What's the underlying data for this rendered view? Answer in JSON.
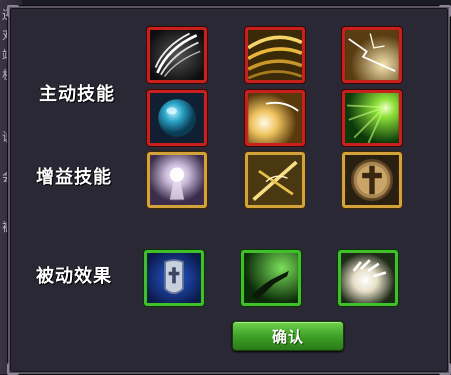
{
  "background": {
    "left_edge_text": [
      "还",
      "对",
      "端",
      "机",
      "说",
      "会",
      "裤"
    ]
  },
  "sections": {
    "active_label": "主动技能",
    "buff_label": "增益技能",
    "passive_label": "被动效果"
  },
  "skills": {
    "active": [
      {
        "icon": "white-slash-skill-icon",
        "frame_color": "#c8201c"
      },
      {
        "icon": "golden-wave-skill-icon",
        "frame_color": "#c8201c"
      },
      {
        "icon": "lightning-strike-skill-icon",
        "frame_color": "#c8201c"
      },
      {
        "icon": "blue-orb-skill-icon",
        "frame_color": "#c8201c"
      },
      {
        "icon": "light-burst-skill-icon",
        "frame_color": "#c8201c"
      },
      {
        "icon": "green-radiance-skill-icon",
        "frame_color": "#c8201c"
      }
    ],
    "buff": [
      {
        "icon": "holy-aura-skill-icon",
        "frame_color": "#d4a23a"
      },
      {
        "icon": "golden-cross-blade-skill-icon",
        "frame_color": "#d4a23a"
      },
      {
        "icon": "holy-cross-skill-icon",
        "frame_color": "#d4a23a"
      }
    ],
    "passive": [
      {
        "icon": "shield-cross-passive-icon",
        "frame_color": "#3fbf2a"
      },
      {
        "icon": "green-hand-passive-icon",
        "frame_color": "#3fbf2a"
      },
      {
        "icon": "light-hand-passive-icon",
        "frame_color": "#3fbf2a"
      }
    ]
  },
  "confirm_button": {
    "label": "确认",
    "color": "#3fa127"
  }
}
